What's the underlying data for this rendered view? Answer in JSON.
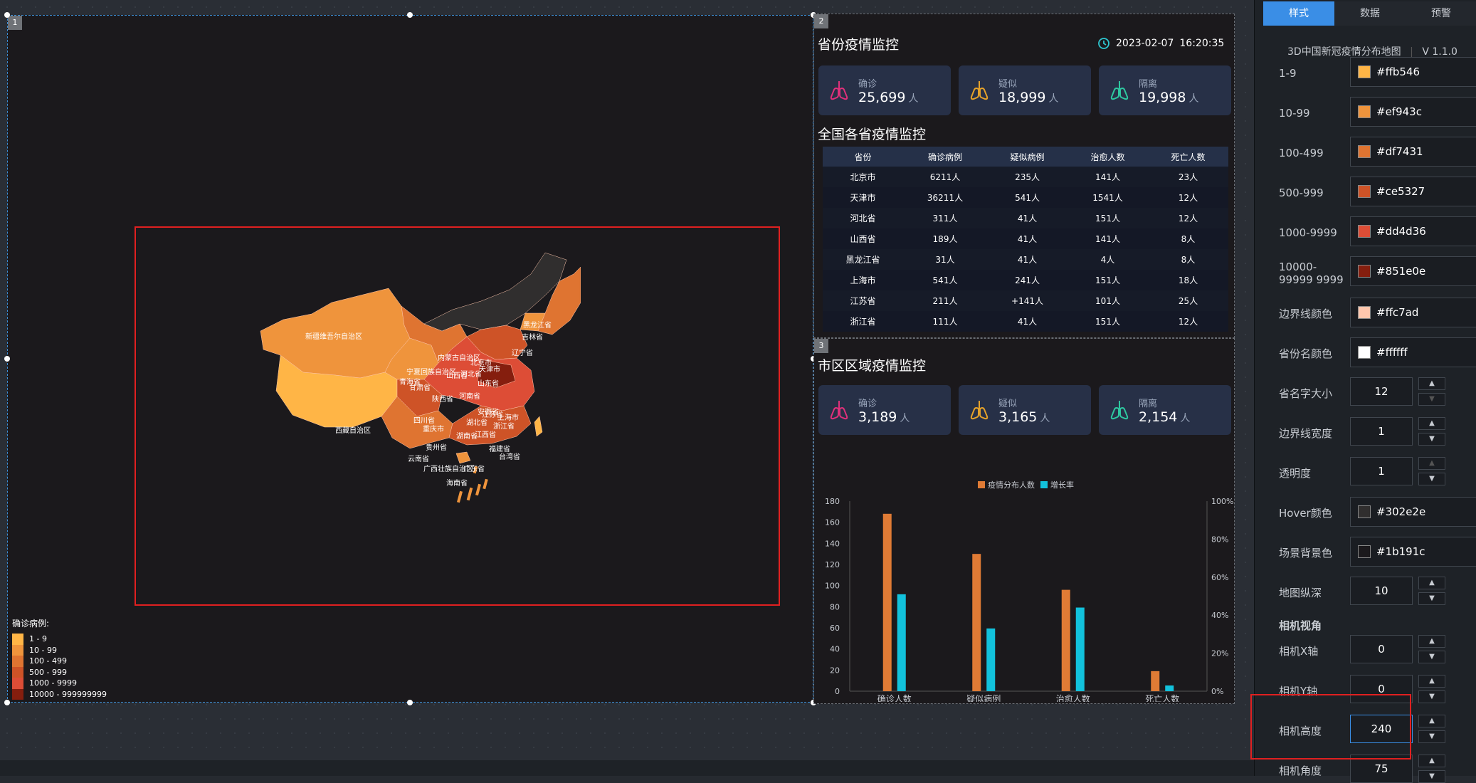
{
  "panel1": {
    "badge": "1",
    "legend": {
      "title": "确诊病例:",
      "items": [
        {
          "label": "1 - 9",
          "color": "#ffb546"
        },
        {
          "label": "10 - 99",
          "color": "#ef943c"
        },
        {
          "label": "100 - 499",
          "color": "#df7431"
        },
        {
          "label": "500 - 999",
          "color": "#ce5327"
        },
        {
          "label": "1000 - 9999",
          "color": "#dd4d36"
        },
        {
          "label": "10000 - 999999999",
          "color": "#851e0e"
        }
      ]
    },
    "map_labels": [
      "新疆维吾尔自治区",
      "西藏自治区",
      "黑龙江省",
      "吉林省",
      "辽宁省",
      "内蒙古自治区",
      "北京市",
      "天津市",
      "河北省",
      "山西省",
      "山东省",
      "宁夏回族自治区",
      "甘肃省",
      "青海省",
      "陕西省",
      "河南省",
      "四川省",
      "重庆市",
      "湖北省",
      "安徽省",
      "江苏省",
      "上海市",
      "浙江省",
      "湖南省",
      "江西省",
      "贵州省",
      "云南省",
      "福建省",
      "广西壮族自治区",
      "广东省",
      "台湾省",
      "海南省"
    ]
  },
  "panel2": {
    "badge": "2",
    "title": "省份疫情监控",
    "date": "2023-02-07",
    "time": "16:20:35",
    "cards": [
      {
        "label": "确诊",
        "value": "25,699",
        "unit": "人",
        "color": "#e0307a"
      },
      {
        "label": "疑似",
        "value": "18,999",
        "unit": "人",
        "color": "#e6a22a"
      },
      {
        "label": "隔离",
        "value": "19,998",
        "unit": "人",
        "color": "#2ec7a0"
      }
    ],
    "table_title": "全国各省疫情监控",
    "columns": [
      "省份",
      "确诊病例",
      "疑似病例",
      "治愈人数",
      "死亡人数"
    ],
    "rows": [
      [
        "北京市",
        "6211人",
        "235人",
        "141人",
        "23人"
      ],
      [
        "天津市",
        "36211人",
        "541人",
        "1541人",
        "12人"
      ],
      [
        "河北省",
        "311人",
        "41人",
        "151人",
        "12人"
      ],
      [
        "山西省",
        "189人",
        "41人",
        "141人",
        "8人"
      ],
      [
        "黑龙江省",
        "31人",
        "41人",
        "4人",
        "8人"
      ],
      [
        "上海市",
        "541人",
        "241人",
        "151人",
        "18人"
      ],
      [
        "江苏省",
        "211人",
        "+141人",
        "101人",
        "25人"
      ],
      [
        "浙江省",
        "111人",
        "41人",
        "151人",
        "12人"
      ]
    ]
  },
  "panel3": {
    "badge": "3",
    "title": "市区区域疫情监控",
    "cards": [
      {
        "label": "确诊",
        "value": "3,189",
        "unit": "人",
        "color": "#e0307a"
      },
      {
        "label": "疑似",
        "value": "3,165",
        "unit": "人",
        "color": "#e6a22a"
      },
      {
        "label": "隔离",
        "value": "2,154",
        "unit": "人",
        "color": "#2ec7a0"
      }
    ]
  },
  "chart_data": {
    "type": "bar",
    "categories": [
      "确诊人数",
      "疑似病例",
      "治愈人数",
      "死亡人数"
    ],
    "series": [
      {
        "name": "疫情分布人数",
        "values": [
          168,
          130,
          96,
          19
        ],
        "color": "#e07b35",
        "axis": "left"
      },
      {
        "name": "增长率",
        "values": [
          0.51,
          0.33,
          0.44,
          0.03
        ],
        "color": "#12c2dc",
        "axis": "right"
      }
    ],
    "y_left": {
      "ticks": [
        "0",
        "20",
        "40",
        "60",
        "80",
        "100",
        "120",
        "140",
        "160",
        "180"
      ],
      "range": [
        0,
        180
      ]
    },
    "y_right": {
      "ticks": [
        "0%",
        "20%",
        "40%",
        "60%",
        "80%",
        "100%"
      ],
      "range": [
        0,
        1
      ]
    },
    "legend_position": "top-center"
  },
  "sidebar": {
    "tabs": [
      "样式",
      "数据",
      "预警"
    ],
    "active_tab": "样式",
    "app_title": "3D中国新冠疫情分布地图",
    "version": "V 1.1.0",
    "color_props": [
      {
        "label": "1-9",
        "value": "#ffb546"
      },
      {
        "label": "10-99",
        "value": "#ef943c"
      },
      {
        "label": "100-499",
        "value": "#df7431"
      },
      {
        "label": "500-999",
        "value": "#ce5327"
      },
      {
        "label": "1000-9999",
        "value": "#dd4d36"
      },
      {
        "label": "10000-99999 9999",
        "value": "#851e0e"
      },
      {
        "label": "边界线颜色",
        "value": "#ffc7ad"
      },
      {
        "label": "省份名颜色",
        "value": "#ffffff"
      }
    ],
    "font_size": {
      "label": "省名字大小",
      "value": "12"
    },
    "border_width": {
      "label": "边界线宽度",
      "value": "1"
    },
    "opacity": {
      "label": "透明度",
      "value": "1"
    },
    "hover_color": {
      "label": "Hover颜色",
      "value": "#302e2e"
    },
    "scene_bg": {
      "label": "场景背景色",
      "value": "#1b191c"
    },
    "map_depth": {
      "label": "地图纵深",
      "value": "10"
    },
    "camera_section": "相机视角",
    "camera_x": {
      "label": "相机X轴",
      "value": "0"
    },
    "camera_y": {
      "label": "相机Y轴",
      "value": "0"
    },
    "camera_height": {
      "label": "相机高度",
      "value": "240"
    },
    "camera_angle": {
      "label": "相机角度",
      "value": "75"
    }
  }
}
